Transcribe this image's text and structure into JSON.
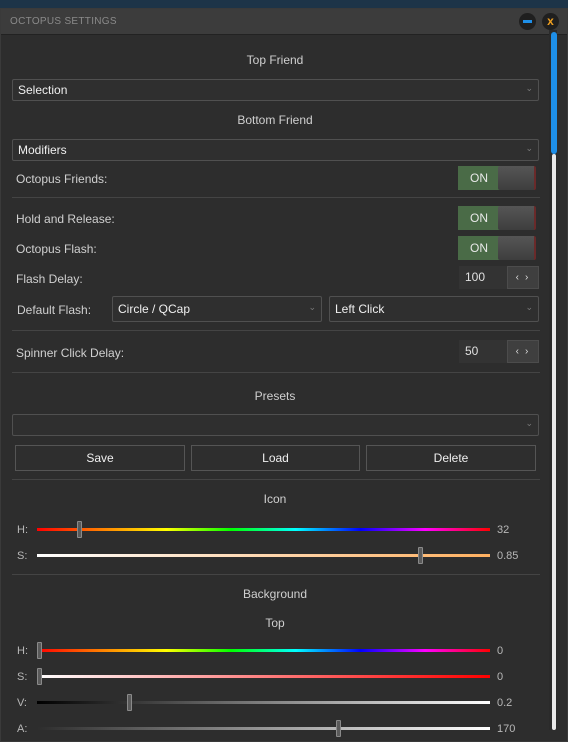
{
  "window": {
    "title": "OCTOPUS SETTINGS",
    "minimize": "minimize",
    "close": "x"
  },
  "top_friend": {
    "label": "Top Friend",
    "value": "Selection"
  },
  "bottom_friend": {
    "label": "Bottom Friend",
    "value": "Modifiers"
  },
  "toggles": {
    "octopus_friends": {
      "label": "Octopus Friends:",
      "state": "ON"
    },
    "hold_release": {
      "label": "Hold and Release:",
      "state": "ON"
    },
    "octopus_flash": {
      "label": "Octopus Flash:",
      "state": "ON"
    }
  },
  "flash_delay": {
    "label": "Flash Delay:",
    "value": "100"
  },
  "default_flash": {
    "label": "Default Flash:",
    "shape": "Circle / QCap",
    "click": "Left Click"
  },
  "spinner_delay": {
    "label": "Spinner Click Delay:",
    "value": "50"
  },
  "presets": {
    "label": "Presets",
    "value": "",
    "save": "Save",
    "load": "Load",
    "delete": "Delete"
  },
  "icon": {
    "label": "Icon",
    "h": {
      "label": "H:",
      "value": "32",
      "fraction": 0.09
    },
    "s": {
      "label": "S:",
      "value": "0.85",
      "fraction": 0.85
    }
  },
  "background": {
    "label": "Background",
    "top_label": "Top",
    "h": {
      "label": "H:",
      "value": "0",
      "fraction": 0.0
    },
    "s": {
      "label": "S:",
      "value": "0",
      "fraction": 0.0
    },
    "v": {
      "label": "V:",
      "value": "0.2",
      "fraction": 0.2
    },
    "a": {
      "label": "A:",
      "value": "170",
      "fraction": 0.667
    }
  },
  "colors": {
    "accent": "#1e8fe8",
    "toggle_on": "#4a6b47",
    "close": "#f0a020"
  }
}
